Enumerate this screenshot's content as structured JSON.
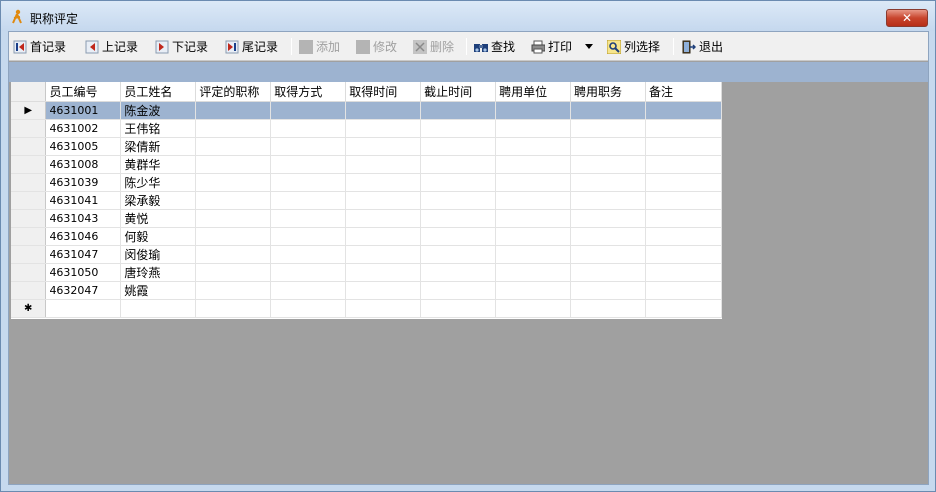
{
  "window": {
    "title": "职称评定",
    "close_label": "✕"
  },
  "toolbar": {
    "first": "首记录",
    "prev": "上记录",
    "next": "下记录",
    "last": "尾记录",
    "add": "添加",
    "edit": "修改",
    "delete": "删除",
    "find": "查找",
    "print": "打印",
    "columns": "列选择",
    "exit": "退出"
  },
  "table": {
    "columns": [
      "员工编号",
      "员工姓名",
      "评定的职称",
      "取得方式",
      "取得时间",
      "截止时间",
      "聘用单位",
      "聘用职务",
      "备注"
    ],
    "rows": [
      {
        "id": "4631001",
        "name": "陈金波"
      },
      {
        "id": "4631002",
        "name": "王伟铭"
      },
      {
        "id": "4631005",
        "name": "梁倩新"
      },
      {
        "id": "4631008",
        "name": "黄群华"
      },
      {
        "id": "4631039",
        "name": "陈少华"
      },
      {
        "id": "4631041",
        "name": "梁承毅"
      },
      {
        "id": "4631043",
        "name": "黄悦"
      },
      {
        "id": "4631046",
        "name": "何毅"
      },
      {
        "id": "4631047",
        "name": "闵俊瑜"
      },
      {
        "id": "4631050",
        "name": "唐玲燕"
      },
      {
        "id": "4632047",
        "name": "姚霞"
      }
    ],
    "current_marker": "▶",
    "new_row_marker": "✱"
  },
  "colors": {
    "selected_row": "#9db3d0",
    "workspace": "#a0a0a0",
    "close_button": "#c8452d"
  }
}
